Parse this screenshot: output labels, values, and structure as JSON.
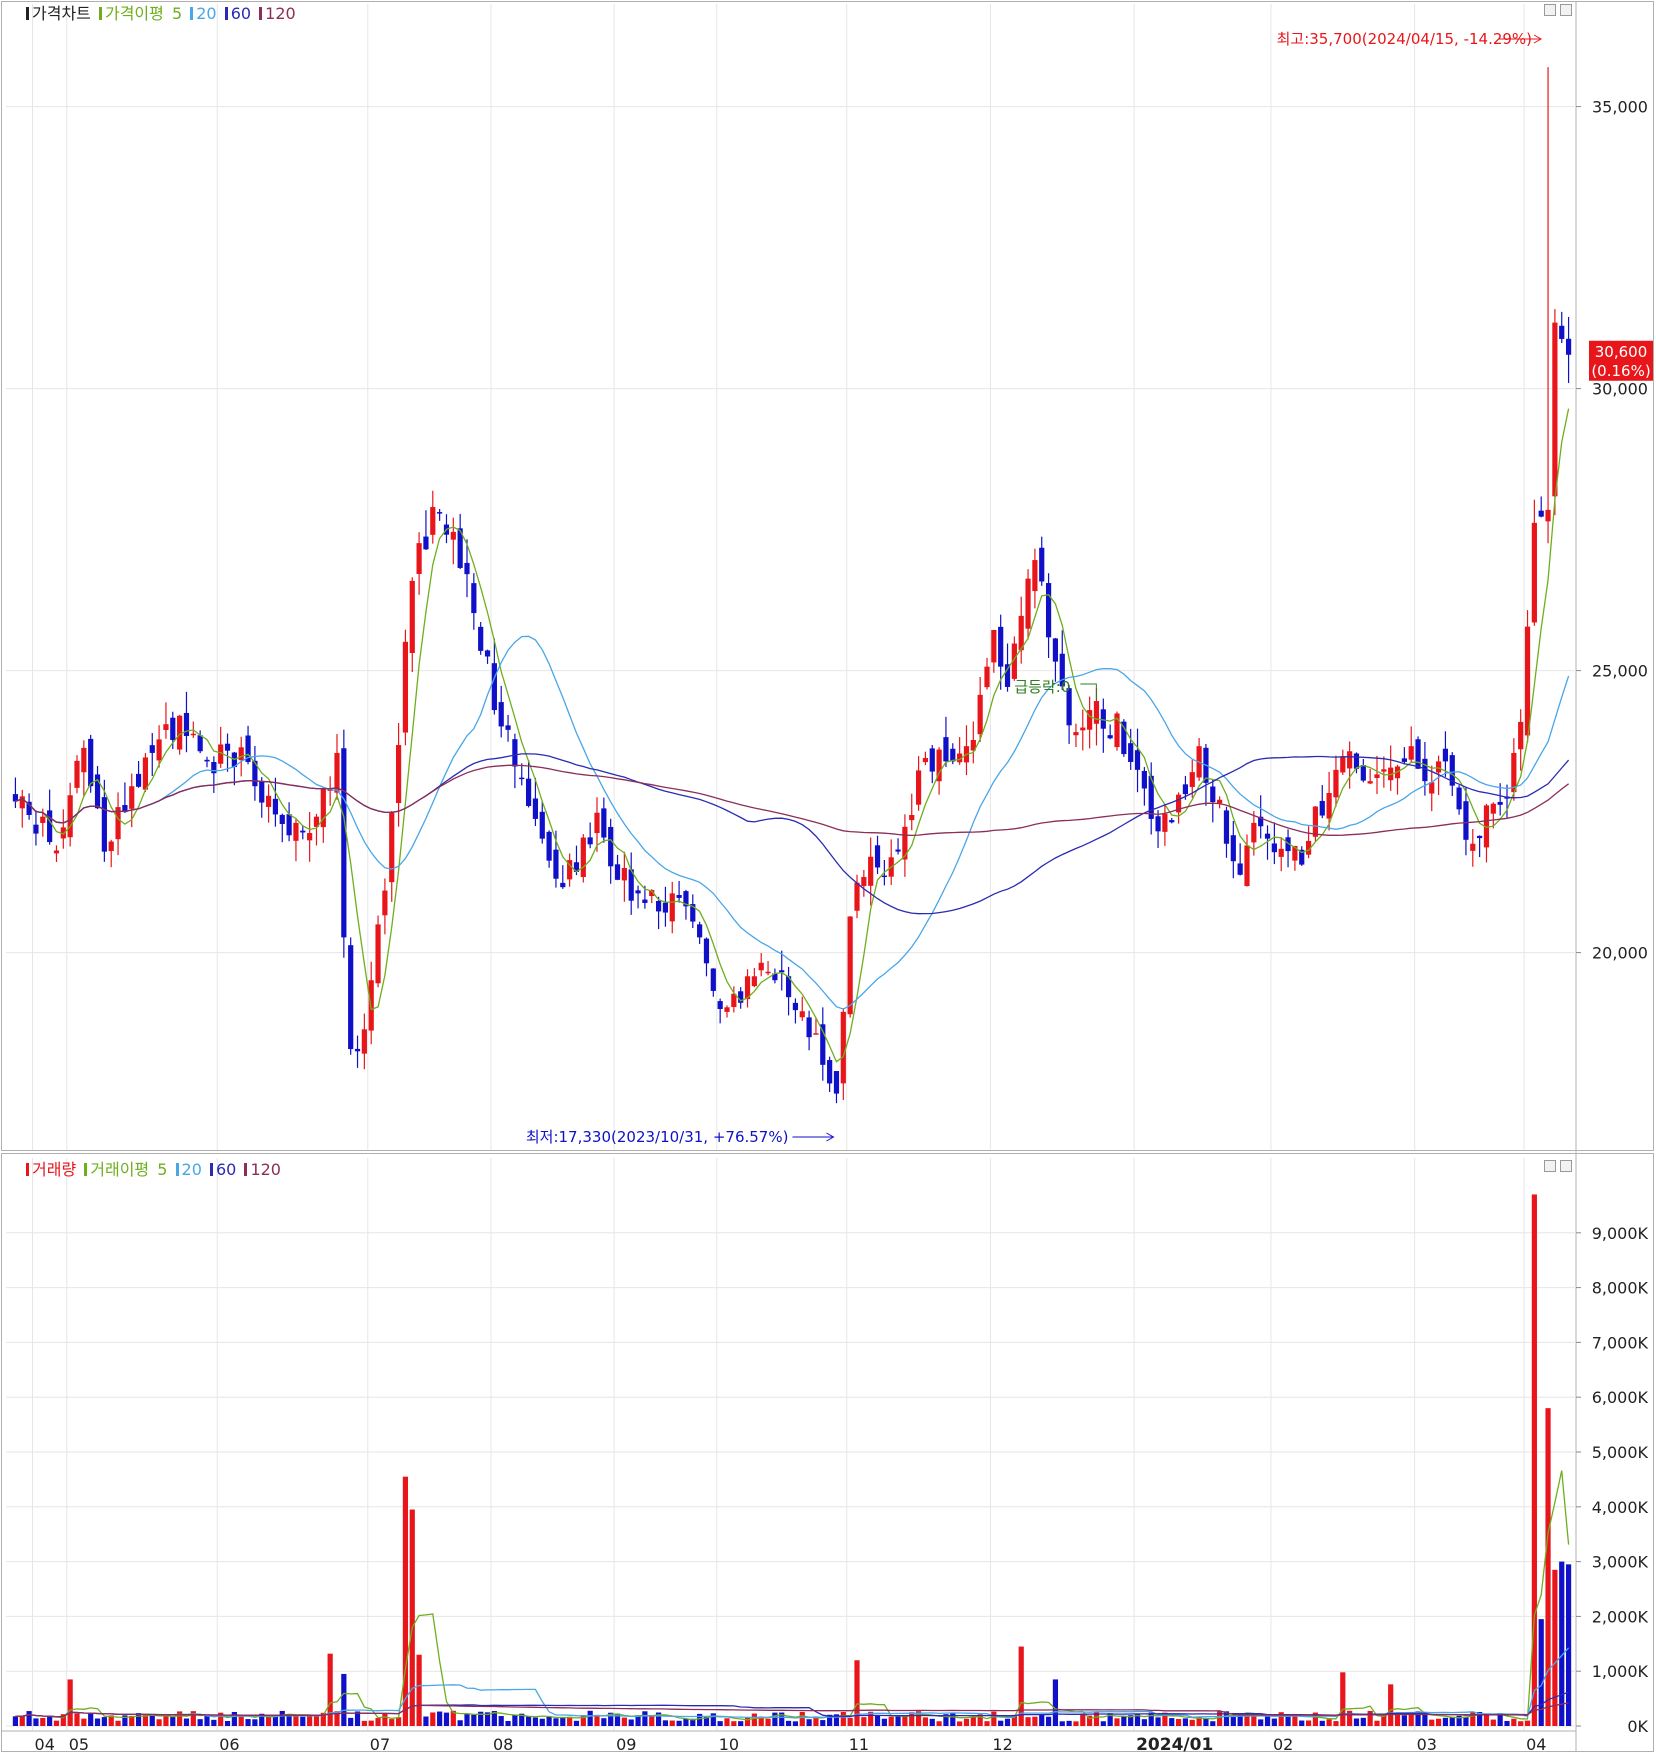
{
  "price_panel": {
    "legend": {
      "chart_label": "가격차트",
      "ma_label": "가격이평",
      "periods": [
        "5",
        "20",
        "60",
        "120"
      ]
    },
    "annotations": {
      "high": "최고:35,700(2024/04/15, -14.29%)",
      "low": "최저:17,330(2023/10/31, +76.57%)",
      "event_tag": "급등락:0"
    },
    "last_price_badge": {
      "price": "30,600",
      "change": "(0.16%)"
    }
  },
  "volume_panel": {
    "legend": {
      "chart_label": "거래량",
      "ma_label": "거래이평",
      "periods": [
        "5",
        "20",
        "60",
        "120"
      ]
    }
  },
  "colors": {
    "up": "#e8161b",
    "down": "#1010c8",
    "ma5": "#6fae1e",
    "ma20": "#49a6e8",
    "ma60": "#2a2ab4",
    "ma120": "#8b2e58",
    "grid": "#e6e6e6",
    "border": "#b0b0b0"
  },
  "chart_data": [
    {
      "type": "candlestick",
      "name": "price",
      "x_labels": [
        "04",
        "05",
        "06",
        "07",
        "08",
        "09",
        "10",
        "11",
        "12",
        "2024/01",
        "02",
        "03",
        "04"
      ],
      "y_ticks": [
        "35,000",
        "30,000",
        "25,000",
        "20,000"
      ],
      "ylim": [
        16500,
        36500
      ],
      "grid": true,
      "moving_averages": [
        5,
        20,
        60,
        120
      ],
      "high": {
        "value": 35700,
        "date": "2024/04/15"
      },
      "low": {
        "value": 17330,
        "date": "2023/10/31"
      },
      "last_close": 30600,
      "anchors": [
        [
          0,
          22800
        ],
        [
          3,
          22300
        ],
        [
          6,
          21800
        ],
        [
          10,
          23800
        ],
        [
          13,
          22000
        ],
        [
          16,
          22500
        ],
        [
          20,
          23700
        ],
        [
          24,
          24100
        ],
        [
          28,
          23300
        ],
        [
          32,
          23500
        ],
        [
          36,
          22900
        ],
        [
          40,
          22100
        ],
        [
          44,
          22300
        ],
        [
          47,
          23400
        ],
        [
          48,
          20500
        ],
        [
          49,
          18200
        ],
        [
          51,
          18700
        ],
        [
          54,
          21200
        ],
        [
          56,
          23800
        ],
        [
          58,
          26800
        ],
        [
          61,
          27800
        ],
        [
          64,
          27400
        ],
        [
          66,
          26600
        ],
        [
          68,
          25500
        ],
        [
          70,
          24500
        ],
        [
          73,
          23300
        ],
        [
          76,
          22200
        ],
        [
          79,
          21200
        ],
        [
          82,
          21600
        ],
        [
          85,
          22400
        ],
        [
          88,
          21300
        ],
        [
          91,
          21100
        ],
        [
          94,
          20800
        ],
        [
          97,
          21000
        ],
        [
          100,
          20400
        ],
        [
          103,
          19100
        ],
        [
          106,
          19300
        ],
        [
          109,
          19700
        ],
        [
          112,
          19500
        ],
        [
          115,
          18900
        ],
        [
          118,
          18200
        ],
        [
          120,
          17600
        ],
        [
          121,
          18800
        ],
        [
          122,
          20400
        ],
        [
          124,
          21600
        ],
        [
          127,
          21500
        ],
        [
          130,
          22000
        ],
        [
          133,
          23500
        ],
        [
          136,
          23300
        ],
        [
          139,
          23600
        ],
        [
          141,
          24400
        ],
        [
          143,
          25500
        ],
        [
          145,
          25000
        ],
        [
          147,
          26000
        ],
        [
          149,
          27200
        ],
        [
          151,
          25900
        ],
        [
          153,
          24700
        ],
        [
          155,
          23800
        ],
        [
          158,
          24200
        ],
        [
          161,
          24000
        ],
        [
          164,
          23000
        ],
        [
          167,
          22100
        ],
        [
          170,
          22800
        ],
        [
          173,
          23400
        ],
        [
          176,
          22500
        ],
        [
          179,
          21500
        ],
        [
          182,
          22500
        ],
        [
          185,
          21800
        ],
        [
          188,
          21600
        ],
        [
          191,
          22700
        ],
        [
          194,
          23600
        ],
        [
          197,
          22900
        ],
        [
          200,
          23300
        ],
        [
          203,
          23600
        ],
        [
          206,
          23100
        ],
        [
          209,
          23400
        ],
        [
          212,
          22100
        ],
        [
          215,
          22400
        ],
        [
          218,
          22800
        ],
        [
          220,
          24200
        ],
        [
          222,
          27500
        ],
        [
          224,
          27800
        ],
        [
          225,
          31500
        ],
        [
          226,
          30900
        ],
        [
          227,
          30600
        ]
      ]
    },
    {
      "type": "bar",
      "name": "volume",
      "unit": "K",
      "y_ticks": [
        "9,000K",
        "8,000K",
        "7,000K",
        "6,000K",
        "5,000K",
        "4,000K",
        "3,000K",
        "2,000K",
        "1,000K",
        "0K"
      ],
      "ylim": [
        0,
        10000
      ],
      "grid": true,
      "moving_averages": [
        5,
        20,
        60,
        120
      ],
      "spikes": [
        [
          8,
          850
        ],
        [
          46,
          1320
        ],
        [
          48,
          950
        ],
        [
          57,
          4550
        ],
        [
          58,
          3950
        ],
        [
          59,
          1300
        ],
        [
          123,
          1200
        ],
        [
          147,
          1450
        ],
        [
          152,
          850
        ],
        [
          194,
          980
        ],
        [
          201,
          760
        ],
        [
          222,
          9700
        ],
        [
          223,
          1950
        ],
        [
          224,
          5800
        ],
        [
          225,
          2850
        ],
        [
          226,
          3000
        ],
        [
          227,
          2950
        ]
      ],
      "base_volume": 180
    }
  ]
}
